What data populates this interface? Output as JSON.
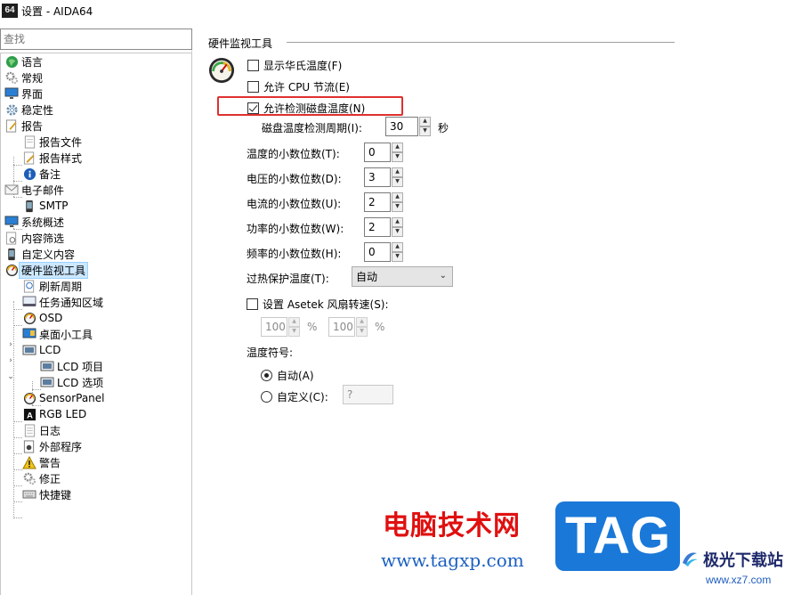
{
  "window": {
    "app_icon_text": "64",
    "title": "设置 - AIDA64"
  },
  "search": {
    "placeholder": "查找"
  },
  "tree": [
    {
      "label": "语言",
      "icon": "globe-icon"
    },
    {
      "label": "常规",
      "icon": "gears-icon"
    },
    {
      "label": "界面",
      "icon": "monitor-icon"
    },
    {
      "label": "稳定性",
      "icon": "gear-icon"
    },
    {
      "label": "报告",
      "icon": "report-icon"
    },
    {
      "label": "报告文件",
      "icon": "document-icon"
    },
    {
      "label": "报告样式",
      "icon": "edit-document-icon"
    },
    {
      "label": "备注",
      "icon": "info-icon"
    },
    {
      "label": "电子邮件",
      "icon": "email-icon"
    },
    {
      "label": "SMTP",
      "icon": "phone-icon"
    },
    {
      "label": "系统概述",
      "icon": "monitor-icon"
    },
    {
      "label": "内容筛选",
      "icon": "filter-icon"
    },
    {
      "label": "自定义内容",
      "icon": "phone-icon"
    },
    {
      "label": "硬件监视工具",
      "icon": "gauge-icon"
    },
    {
      "label": "刷新周期",
      "icon": "clock-document-icon"
    },
    {
      "label": "任务通知区域",
      "icon": "taskbar-icon"
    },
    {
      "label": "OSD",
      "icon": "gauge-icon"
    },
    {
      "label": "桌面小工具",
      "icon": "gadget-icon"
    },
    {
      "label": "LCD",
      "icon": "lcd-icon"
    },
    {
      "label": "LCD 项目",
      "icon": "lcd-icon"
    },
    {
      "label": "LCD 选项",
      "icon": "lcd-icon"
    },
    {
      "label": "SensorPanel",
      "icon": "gauge-icon"
    },
    {
      "label": "RGB LED",
      "icon": "rgb-icon"
    },
    {
      "label": "日志",
      "icon": "log-icon"
    },
    {
      "label": "外部程序",
      "icon": "program-icon"
    },
    {
      "label": "警告",
      "icon": "warning-icon"
    },
    {
      "label": "修正",
      "icon": "gears-icon"
    },
    {
      "label": "快捷键",
      "icon": "keyboard-icon"
    }
  ],
  "panel": {
    "section_title": "硬件监视工具",
    "show_fahrenheit": "显示华氏温度(F)",
    "allow_cpu_throttle": "允许 CPU 节流(E)",
    "allow_disk_temp": "允许检测磁盘温度(N)",
    "disk_temp_period_label": "磁盘温度检测周期(I):",
    "disk_temp_period_value": "30",
    "seconds_unit": "秒",
    "temp_decimals_label": "温度的小数位数(T):",
    "temp_decimals_value": "0",
    "voltage_decimals_label": "电压的小数位数(D):",
    "voltage_decimals_value": "3",
    "current_decimals_label": "电流的小数位数(U):",
    "current_decimals_value": "2",
    "power_decimals_label": "功率的小数位数(W):",
    "power_decimals_value": "2",
    "freq_decimals_label": "频率的小数位数(H):",
    "freq_decimals_value": "0",
    "overheat_label": "过热保护温度(T):",
    "overheat_value": "自动",
    "asetek_label": "设置 Asetek 风扇转速(S):",
    "asetek_value_1": "100",
    "asetek_value_2": "100",
    "percent": "%",
    "temp_symbol_label": "温度符号:",
    "radio_auto": "自动(A)",
    "radio_custom": "自定义(C):",
    "custom_symbol_value": "?"
  },
  "state": {
    "show_fahrenheit": false,
    "allow_cpu_throttle": false,
    "allow_disk_temp": true,
    "asetek": false,
    "temp_symbol": "auto",
    "selected_tree_item": "硬件监视工具"
  },
  "watermark": {
    "cn_text": "电脑技术网",
    "url": "www.tagxp.com",
    "tag": "TAG",
    "logo_text": "极光下载站",
    "logo_url": "www.xz7.com"
  },
  "colors": {
    "highlight_box": "#e03030",
    "selection": "#cce8ff",
    "watermark_red": "#e01010",
    "watermark_blue": "#1a78d8"
  }
}
